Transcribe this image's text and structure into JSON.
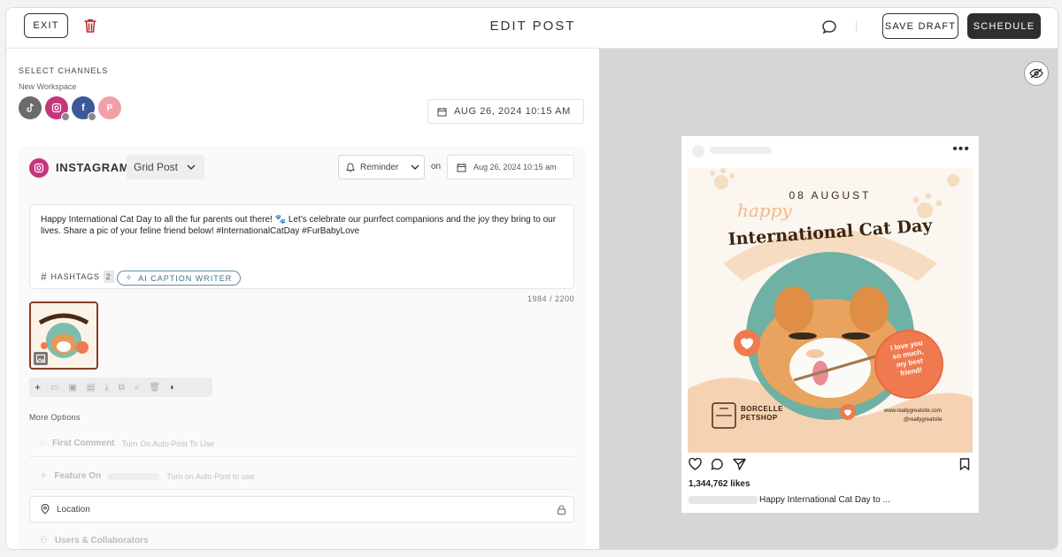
{
  "header": {
    "exit_label": "EXIT",
    "title": "EDIT POST",
    "save_draft_label": "SAVE DRAFT",
    "schedule_label": "SCHEDULE"
  },
  "channels": {
    "label": "SELECT CHANNELS",
    "workspace": "New Workspace",
    "items": [
      {
        "name": "tiktok",
        "color": "#6b6b6b"
      },
      {
        "name": "instagram",
        "color": "#c4367e"
      },
      {
        "name": "facebook",
        "color": "#3b5998"
      },
      {
        "name": "pinterest",
        "color": "#f1a0a7"
      }
    ]
  },
  "schedule_date": "AUG 26, 2024 10:15 AM",
  "instagram": {
    "label": "INSTAGRAM",
    "post_type": "Grid Post",
    "reminder_label": "Reminder",
    "on_label": "on",
    "date": "Aug 26, 2024 10:15 am",
    "caption": "Happy International Cat Day to all the fur parents out there! 🐾 Let’s celebrate our purrfect companions and the joy they bring to our lives. Share a pic of your feline friend below! #InternationalCatDay #FurBabyLove",
    "hashtags_label": "HASHTAGS",
    "hashtags_count": "2",
    "ai_caption_label": "AI CAPTION WRITER",
    "char_count": "1984 / 2200"
  },
  "more_options": {
    "label": "More Options",
    "first_comment": {
      "label": "First Comment",
      "sub": "Turn On Auto-Post To Use"
    },
    "feature_on": {
      "label": "Feature On",
      "sub": "Turn on Auto-Post to use"
    },
    "location": {
      "label": "Location"
    },
    "users": {
      "label": "Users & Collaborators"
    }
  },
  "preview": {
    "post_image": {
      "date": "08 AUGUST",
      "happy": "happy",
      "headline": "International Cat Day",
      "bubble_line1": "I love you",
      "bubble_line2": "so much,",
      "bubble_line3": "my best",
      "bubble_line4": "friend!",
      "brand_line1": "BORCELLE",
      "brand_line2": "PETSHOP",
      "site": "www.reallygreatsite.com",
      "handle": "@reallygreatsite"
    },
    "likes": "1,344,762 likes",
    "caption": "Happy International Cat Day to ..."
  },
  "colors": {
    "accent_dark": "#2f2f2f",
    "instagram": "#c4367e",
    "ai_blue": "#44718a",
    "post_peach": "#f4c9a6",
    "post_orange": "#f07a4f",
    "post_teal": "#6fb1a4"
  }
}
